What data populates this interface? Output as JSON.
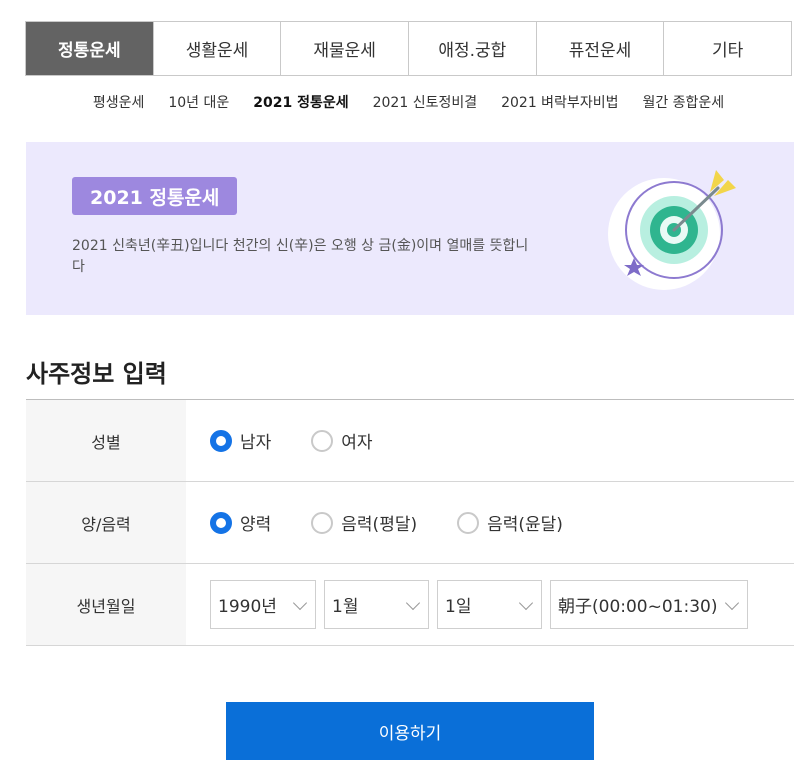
{
  "tabs": [
    {
      "label": "정통운세",
      "active": true
    },
    {
      "label": "생활운세",
      "active": false
    },
    {
      "label": "재물운세",
      "active": false
    },
    {
      "label": "애정.궁합",
      "active": false
    },
    {
      "label": "퓨전운세",
      "active": false
    },
    {
      "label": "기타",
      "active": false
    }
  ],
  "subnav": [
    {
      "label": "평생운세",
      "active": false
    },
    {
      "label": "10년 대운",
      "active": false
    },
    {
      "label": "2021 정통운세",
      "active": true
    },
    {
      "label": "2021 신토정비결",
      "active": false
    },
    {
      "label": "2021 벼락부자비법",
      "active": false
    },
    {
      "label": "월간 종합운세",
      "active": false
    }
  ],
  "banner": {
    "badge": "2021 정통운세",
    "description": "2021 신축년(辛丑)입니다 천간의 신(辛)은 오행 상 금(金)이며 열매를 뜻합니다",
    "icon": "target-dart-icon"
  },
  "section_title": "사주정보 입력",
  "form": {
    "gender": {
      "label": "성별",
      "options": [
        {
          "label": "남자",
          "checked": true
        },
        {
          "label": "여자",
          "checked": false
        }
      ]
    },
    "calendar": {
      "label": "양/음력",
      "options": [
        {
          "label": "양력",
          "checked": true
        },
        {
          "label": "음력(평달)",
          "checked": false
        },
        {
          "label": "음력(윤달)",
          "checked": false
        }
      ]
    },
    "birth": {
      "label": "생년월일",
      "year": "1990년",
      "month": "1월",
      "day": "1일",
      "hour": "朝子(00:00~01:30)"
    }
  },
  "submit_label": "이용하기",
  "colors": {
    "accent": "#0a6fd8",
    "radio_checked": "#1473e6",
    "banner_bg": "#ece9fd",
    "badge_bg": "#9d88df",
    "active_tab_bg": "#636363"
  }
}
